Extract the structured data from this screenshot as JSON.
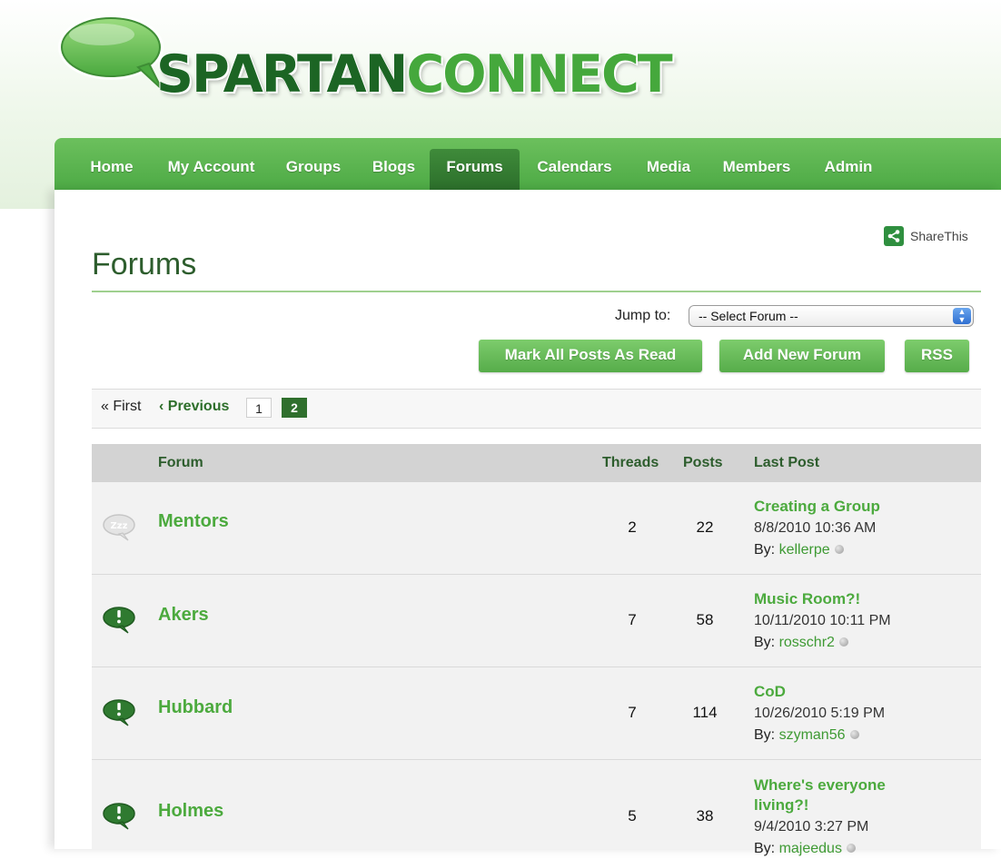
{
  "logo": {
    "part1": "SPARTAN",
    "part2": "CONNECT"
  },
  "nav": {
    "items": [
      {
        "label": "Home"
      },
      {
        "label": "My Account"
      },
      {
        "label": "Groups"
      },
      {
        "label": "Blogs"
      },
      {
        "label": "Forums",
        "active": true
      },
      {
        "label": "Calendars"
      },
      {
        "label": "Media"
      },
      {
        "label": "Members"
      },
      {
        "label": "Admin"
      }
    ]
  },
  "share": {
    "label": "ShareThis"
  },
  "page": {
    "title": "Forums"
  },
  "jump": {
    "label": "Jump to:",
    "selected": "-- Select Forum --"
  },
  "buttons": {
    "mark_read": "Mark All Posts As Read",
    "add_forum": "Add New Forum",
    "rss": "RSS"
  },
  "pager": {
    "first": "« First",
    "previous": "‹ Previous",
    "pages": [
      "1",
      "2"
    ],
    "current": "2"
  },
  "table": {
    "headers": {
      "forum": "Forum",
      "threads": "Threads",
      "posts": "Posts",
      "last_post": "Last Post"
    },
    "rows": [
      {
        "icon": "sleeping-bubble-icon",
        "name": "Mentors",
        "threads": "2",
        "posts": "22",
        "last_title": "Creating a Group",
        "last_date": "8/8/2010 10:36 AM",
        "by_label": "By:",
        "user": "kellerpe"
      },
      {
        "icon": "new-posts-bubble-icon",
        "name": "Akers",
        "threads": "7",
        "posts": "58",
        "last_title": "Music Room?!",
        "last_date": "10/11/2010 10:11 PM",
        "by_label": "By:",
        "user": "rosschr2"
      },
      {
        "icon": "new-posts-bubble-icon",
        "name": "Hubbard",
        "threads": "7",
        "posts": "114",
        "last_title": "CoD",
        "last_date": "10/26/2010 5:19 PM",
        "by_label": "By:",
        "user": "szyman56"
      },
      {
        "icon": "new-posts-bubble-icon",
        "name": "Holmes",
        "threads": "5",
        "posts": "38",
        "last_title": "Where's everyone living?!",
        "last_date": "9/4/2010 3:27 PM",
        "by_label": "By:",
        "user": "majeedus"
      }
    ]
  },
  "colors": {
    "brand_green": "#4caa3e",
    "dark_green": "#2f6f2d",
    "nav_green": "#5cb550"
  }
}
